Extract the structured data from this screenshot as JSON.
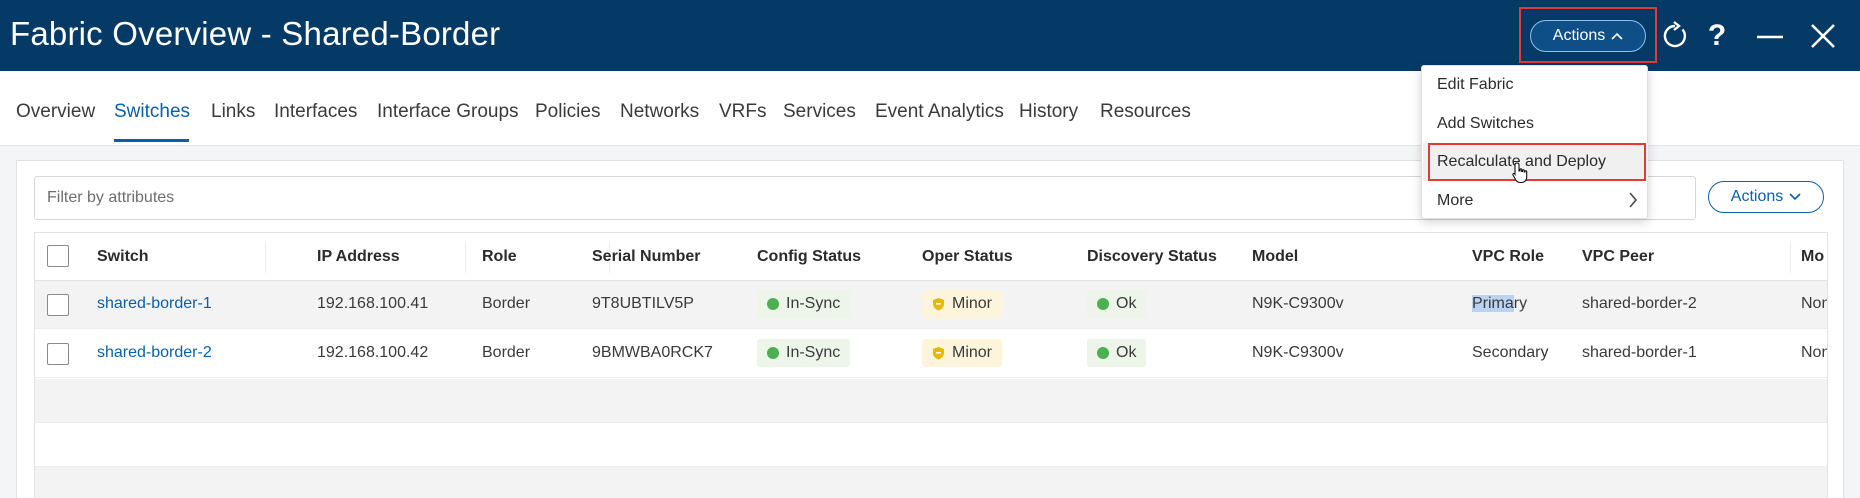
{
  "header": {
    "title": "Fabric Overview - Shared-Border",
    "actions_label": "Actions",
    "icons": [
      "refresh-icon",
      "help-icon",
      "minimize-icon",
      "close-icon"
    ],
    "help_glyph": "?"
  },
  "tabs": [
    {
      "label": "Overview",
      "active": false
    },
    {
      "label": "Switches",
      "active": true
    },
    {
      "label": "Links",
      "active": false
    },
    {
      "label": "Interfaces",
      "active": false
    },
    {
      "label": "Interface Groups",
      "active": false
    },
    {
      "label": "Policies",
      "active": false
    },
    {
      "label": "Networks",
      "active": false
    },
    {
      "label": "VRFs",
      "active": false
    },
    {
      "label": "Services",
      "active": false
    },
    {
      "label": "Event Analytics",
      "active": false
    },
    {
      "label": "History",
      "active": false
    },
    {
      "label": "Resources",
      "active": false
    }
  ],
  "filter": {
    "placeholder": "Filter by attributes"
  },
  "table_actions_label": "Actions",
  "table": {
    "columns": [
      "Switch",
      "IP Address",
      "Role",
      "Serial Number",
      "Config Status",
      "Oper Status",
      "Discovery Status",
      "Model",
      "VPC Role",
      "VPC Peer",
      "Mo"
    ],
    "rows": [
      {
        "switch": "shared-border-1",
        "ip": "192.168.100.41",
        "role": "Border",
        "serial": "9T8UBTILV5P",
        "config_status": "In-Sync",
        "oper_status": "Minor",
        "discovery_status": "Ok",
        "model": "N9K-C9300v",
        "vpc_role_sel": "Prima",
        "vpc_role_rest": "ry",
        "vpc_peer": "shared-border-2",
        "mode": "Non"
      },
      {
        "switch": "shared-border-2",
        "ip": "192.168.100.42",
        "role": "Border",
        "serial": "9BMWBA0RCK7",
        "config_status": "In-Sync",
        "oper_status": "Minor",
        "discovery_status": "Ok",
        "model": "N9K-C9300v",
        "vpc_role_sel": "",
        "vpc_role_rest": "Secondary",
        "vpc_peer": "shared-border-1",
        "mode": "Non"
      }
    ]
  },
  "actions_menu": {
    "items": [
      "Edit Fabric",
      "Add Switches",
      "Recalculate and Deploy",
      "More"
    ],
    "hovered_index": 2
  },
  "colors": {
    "header_bg": "#063a66",
    "accent": "#0a60a8",
    "highlight_border": "#e53935",
    "status_ok": "#4caf50",
    "status_minor": "#e6b800"
  }
}
